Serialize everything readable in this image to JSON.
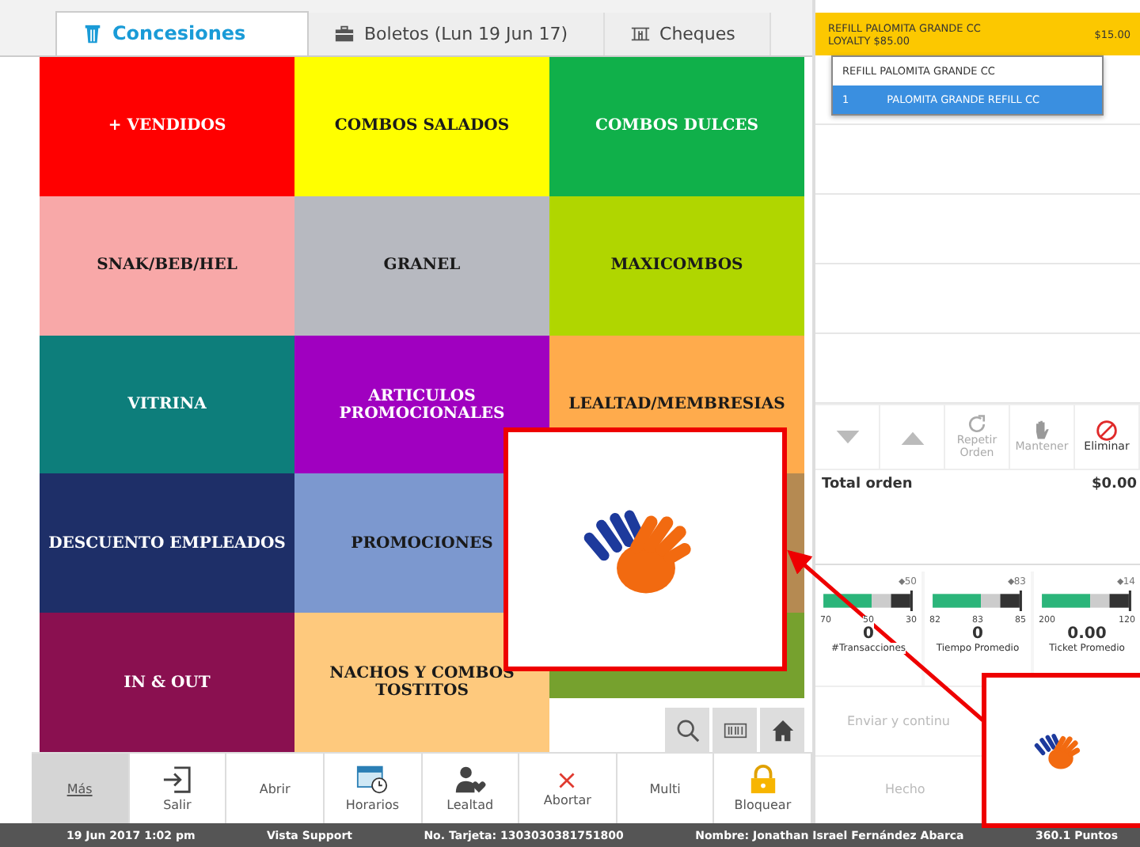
{
  "tabs": [
    {
      "label": "Concesiones",
      "selected": true
    },
    {
      "label": "Boletos (Lun 19 Jun 17)",
      "selected": false
    },
    {
      "label": "Cheques",
      "selected": false
    }
  ],
  "tiles": [
    {
      "label": "+ VENDIDOS",
      "color": "#ff0000"
    },
    {
      "label": "COMBOS SALADOS",
      "color": "#ffff00"
    },
    {
      "label": "COMBOS DULCES",
      "color": "#10b04a"
    },
    {
      "label": "SNAK/BEB/HEL",
      "color": "#f8a8a8"
    },
    {
      "label": "GRANEL",
      "color": "#b7b9c0"
    },
    {
      "label": "MAXICOMBOS",
      "color": "#b0d600"
    },
    {
      "label": "VITRINA",
      "color": "#0d7e7b"
    },
    {
      "label": "ARTICULOS PROMOCIONALES",
      "color": "#a000c0"
    },
    {
      "label": "LEALTAD/MEMBRESIAS",
      "color": "#ffab4c"
    },
    {
      "label": "DESCUENTO EMPLEADOS",
      "color": "#1e2f68"
    },
    {
      "label": "PROMOCIONES",
      "color": "#7c98cf"
    },
    {
      "color": "#b58a52"
    },
    {
      "label": "IN & OUT",
      "color": "#8a1050"
    },
    {
      "label": "NACHOS Y COMBOS TOSTITOS",
      "color": "#fec97d"
    },
    {
      "color": "#76a12e"
    }
  ],
  "toolbar": [
    {
      "kind": "text",
      "label": "Más",
      "selected": true
    },
    {
      "kind": "exit",
      "label": "Salir",
      "selected": false
    },
    {
      "kind": "text",
      "label": "Abrir",
      "selected": false
    },
    {
      "kind": "calendar",
      "label": "Horarios",
      "selected": false
    },
    {
      "kind": "person",
      "label": "Lealtad",
      "selected": false
    },
    {
      "kind": "close",
      "label": "Abortar",
      "selected": false
    },
    {
      "kind": "text",
      "label": "Multi",
      "selected": false
    },
    {
      "kind": "lock",
      "label": "Bloquear",
      "selected": false
    }
  ],
  "order": {
    "item": "REFILL PALOMITA GRANDE CC",
    "note": "LOYALTY $85.00",
    "price": "$15.00"
  },
  "dropdown": {
    "header": "REFILL PALOMITA GRANDE CC",
    "options": [
      {
        "qty": "1",
        "label": "PALOMITA GRANDE REFILL CC",
        "selected": true
      }
    ]
  },
  "actions": [
    {
      "kind": "down",
      "disabled": true
    },
    {
      "kind": "up",
      "disabled": true
    },
    {
      "kind": "repeat",
      "label": "Repetir Orden",
      "disabled": true
    },
    {
      "kind": "hold",
      "label": "Mantener",
      "disabled": true
    },
    {
      "kind": "delete",
      "label": "Eliminar",
      "disabled": false
    }
  ],
  "total": {
    "label": "Total orden",
    "value": "$0.00"
  },
  "gauges": [
    {
      "target": "⬥50",
      "scale": [
        "70",
        "50",
        "30"
      ],
      "value": "0",
      "name": "#Transacciones"
    },
    {
      "target": "⬥83",
      "scale": [
        "82",
        "83",
        "85"
      ],
      "value": "0",
      "name": "Tiempo Promedio"
    },
    {
      "target": "⬥14",
      "scale": [
        "200",
        "120"
      ],
      "value": "0.00",
      "name": "Ticket Promedio"
    }
  ],
  "send_button": "Enviar y continu",
  "done_button": "Hecho",
  "status_bar": [
    "19 Jun 2017 1:02 pm",
    "Vista Support",
    "No. Tarjeta: 1303030381751800",
    "Nombre: Jonathan Israel Fernández Abarca",
    "360.1 Puntos"
  ]
}
